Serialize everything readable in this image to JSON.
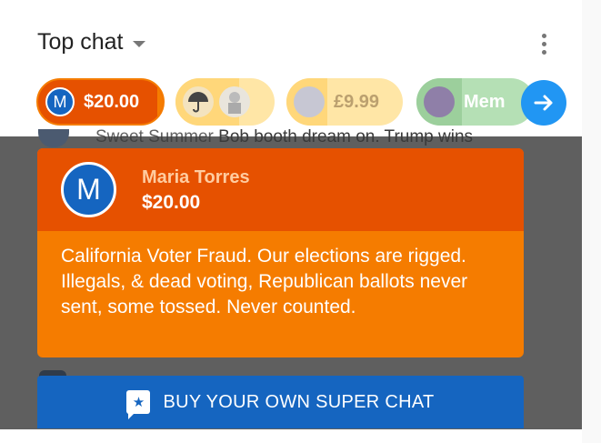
{
  "header": {
    "title": "Top chat"
  },
  "ticker": {
    "chips": [
      {
        "avatar_letter": "M",
        "amount": "$20.00"
      },
      {
        "amount": ""
      },
      {
        "amount": "£9.99"
      },
      {
        "amount": "Mem"
      }
    ]
  },
  "chat": {
    "background_line": {
      "author": "Sweet Summer",
      "message": "Bob booth dream on. Trump wins"
    }
  },
  "superchat": {
    "avatar_letter": "M",
    "author": "Maria Torres",
    "amount": "$20.00",
    "message": "California Voter Fraud. Our elections are rigged. Illegals, & dead voting, Republican ballots never sent, some tossed. Never counted."
  },
  "buy_button": {
    "label": "BUY YOUR OWN SUPER CHAT"
  },
  "colors": {
    "superchat_header": "#e65100",
    "superchat_body": "#f57c00",
    "avatar_blue": "#1565c0",
    "next_button": "#2196f3",
    "overlay": "#5f5f5f"
  }
}
